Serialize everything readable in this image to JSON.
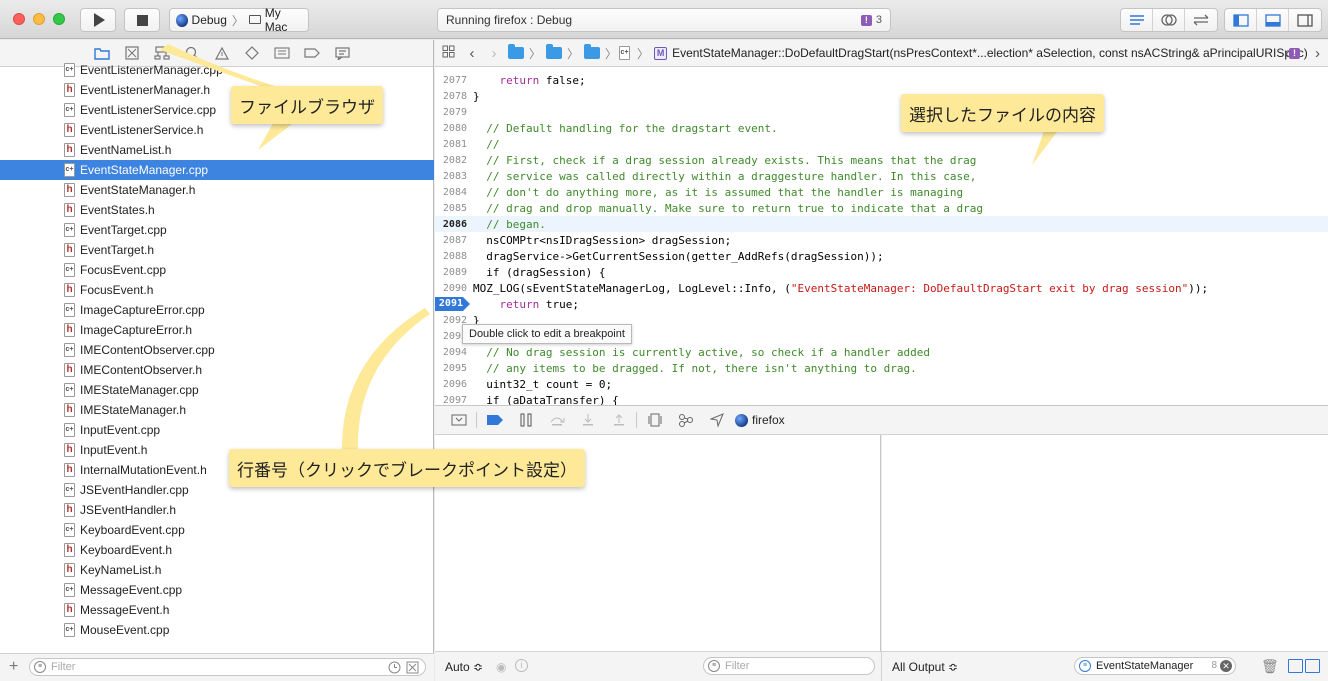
{
  "toolbar": {
    "scheme": "Debug",
    "destination": "My Mac",
    "activity_text": "Running firefox : Debug",
    "issue_count": "3",
    "issue_badge": "!"
  },
  "navigator": {
    "files": [
      {
        "name": "EventListenerManager.cpp",
        "type": "cpp"
      },
      {
        "name": "EventListenerManager.h",
        "type": "h"
      },
      {
        "name": "EventListenerService.cpp",
        "type": "cpp"
      },
      {
        "name": "EventListenerService.h",
        "type": "h"
      },
      {
        "name": "EventNameList.h",
        "type": "h"
      },
      {
        "name": "EventStateManager.cpp",
        "type": "cpp",
        "selected": true
      },
      {
        "name": "EventStateManager.h",
        "type": "h"
      },
      {
        "name": "EventStates.h",
        "type": "h"
      },
      {
        "name": "EventTarget.cpp",
        "type": "cpp"
      },
      {
        "name": "EventTarget.h",
        "type": "h"
      },
      {
        "name": "FocusEvent.cpp",
        "type": "cpp"
      },
      {
        "name": "FocusEvent.h",
        "type": "h"
      },
      {
        "name": "ImageCaptureError.cpp",
        "type": "cpp"
      },
      {
        "name": "ImageCaptureError.h",
        "type": "h"
      },
      {
        "name": "IMEContentObserver.cpp",
        "type": "cpp"
      },
      {
        "name": "IMEContentObserver.h",
        "type": "h"
      },
      {
        "name": "IMEStateManager.cpp",
        "type": "cpp"
      },
      {
        "name": "IMEStateManager.h",
        "type": "h"
      },
      {
        "name": "InputEvent.cpp",
        "type": "cpp"
      },
      {
        "name": "InputEvent.h",
        "type": "h"
      },
      {
        "name": "InternalMutationEvent.h",
        "type": "h"
      },
      {
        "name": "JSEventHandler.cpp",
        "type": "cpp"
      },
      {
        "name": "JSEventHandler.h",
        "type": "h"
      },
      {
        "name": "KeyboardEvent.cpp",
        "type": "cpp"
      },
      {
        "name": "KeyboardEvent.h",
        "type": "h"
      },
      {
        "name": "KeyNameList.h",
        "type": "h"
      },
      {
        "name": "MessageEvent.cpp",
        "type": "cpp"
      },
      {
        "name": "MessageEvent.h",
        "type": "h"
      },
      {
        "name": "MouseEvent.cpp",
        "type": "cpp"
      }
    ],
    "filter_placeholder": "Filter",
    "file_icon_h": "h",
    "file_icon_cpp": "c+"
  },
  "jumpbar": {
    "symbol_badge": "M",
    "symbol": "EventStateManager::DoDefaultDragStart(nsPresContext*...election* aSelection, const nsACString& aPrincipalURISpec)"
  },
  "editor": {
    "lines": [
      {
        "num": "2077",
        "text": "    return false;",
        "style": "kw"
      },
      {
        "num": "2078",
        "text": "}",
        "style": "plain"
      },
      {
        "num": "2079",
        "text": "",
        "style": "plain"
      },
      {
        "num": "2080",
        "text": "  // Default handling for the dragstart event.",
        "style": "comment"
      },
      {
        "num": "2081",
        "text": "  //",
        "style": "comment"
      },
      {
        "num": "2082",
        "text": "  // First, check if a drag session already exists. This means that the drag",
        "style": "comment"
      },
      {
        "num": "2083",
        "text": "  // service was called directly within a draggesture handler. In this case,",
        "style": "comment"
      },
      {
        "num": "2084",
        "text": "  // don't do anything more, as it is assumed that the handler is managing",
        "style": "comment"
      },
      {
        "num": "2085",
        "text": "  // drag and drop manually. Make sure to return true to indicate that a drag",
        "style": "comment"
      },
      {
        "num": "2086",
        "text": "  // began.",
        "style": "comment",
        "current": true
      },
      {
        "num": "2087",
        "text": "  nsCOMPtr<nsIDragSession> dragSession;",
        "style": "plain"
      },
      {
        "num": "2088",
        "text": "  dragService->GetCurrentSession(getter_AddRefs(dragSession));",
        "style": "plain"
      },
      {
        "num": "2089",
        "text": "  if (dragSession) {",
        "style": "plain"
      },
      {
        "num": "2090",
        "text": "MOZ_LOG(sEventStateManagerLog, LogLevel::Info, (\"EventStateManager: DoDefaultDragStart exit by drag session\"));",
        "style": "plain"
      },
      {
        "num": "2091",
        "text": "    return true;",
        "style": "kw",
        "breakpoint": true
      },
      {
        "num": "2092",
        "text": "}",
        "style": "plain"
      },
      {
        "num": "2093",
        "text": "",
        "style": "plain"
      },
      {
        "num": "2094",
        "text": "  // No drag session is currently active, so check if a handler added",
        "style": "comment"
      },
      {
        "num": "2095",
        "text": "  // any items to be dragged. If not, there isn't anything to drag.",
        "style": "comment"
      },
      {
        "num": "2096",
        "text": "  uint32_t count = 0;",
        "style": "plain"
      },
      {
        "num": "2097",
        "text": "  if (aDataTransfer) {",
        "style": "plain"
      }
    ],
    "tooltip": "Double click to edit a breakpoint"
  },
  "debug": {
    "process_name": "firefox",
    "auto_label": "Auto ≎",
    "var_filter_placeholder": "Filter",
    "output_label": "All Output ≎",
    "console_filter_value": "EventStateManager",
    "console_filter_count": "8"
  },
  "callouts": {
    "file_browser": "ファイルブラウザ",
    "file_content": "選択したファイルの内容",
    "line_number": "行番号（クリックでブレークポイント設定）"
  },
  "colors": {
    "selection": "#3d83e0",
    "breakpoint": "#3178d9",
    "callout": "#fde997",
    "comment": "#3f8a2b",
    "keyword": "#a22d9a"
  }
}
